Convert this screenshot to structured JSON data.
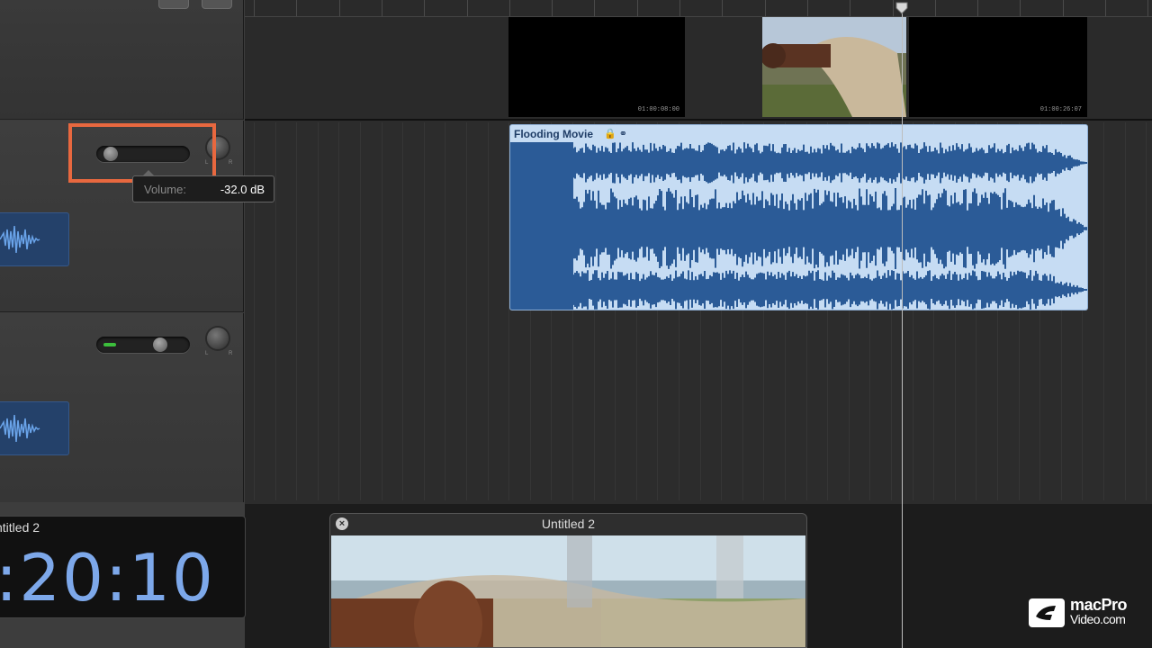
{
  "track1": {
    "volume_tooltip": {
      "label": "Volume:",
      "value": "-32.0 dB"
    },
    "volume_level": 0.05,
    "pan": {
      "left": "L",
      "right": "R"
    }
  },
  "track2": {
    "volume_level": 0.68,
    "pan": {
      "left": "L",
      "right": "R"
    }
  },
  "video_track": {
    "timecodes": [
      "01:00:08:00",
      "01:00:26:07"
    ]
  },
  "audio_region": {
    "title": "Flooding Movie",
    "color": "#c6dcf3",
    "waveform_color": "#2b5b97"
  },
  "lcd": {
    "title": "ntitled 2",
    "time": ":20:10"
  },
  "movie_window": {
    "title": "Untitled 2"
  },
  "watermark": {
    "line1": "macPro",
    "line2": "Video.com"
  },
  "colors": {
    "highlight": "#e8683f",
    "lcd_digits": "#7da8ea"
  }
}
